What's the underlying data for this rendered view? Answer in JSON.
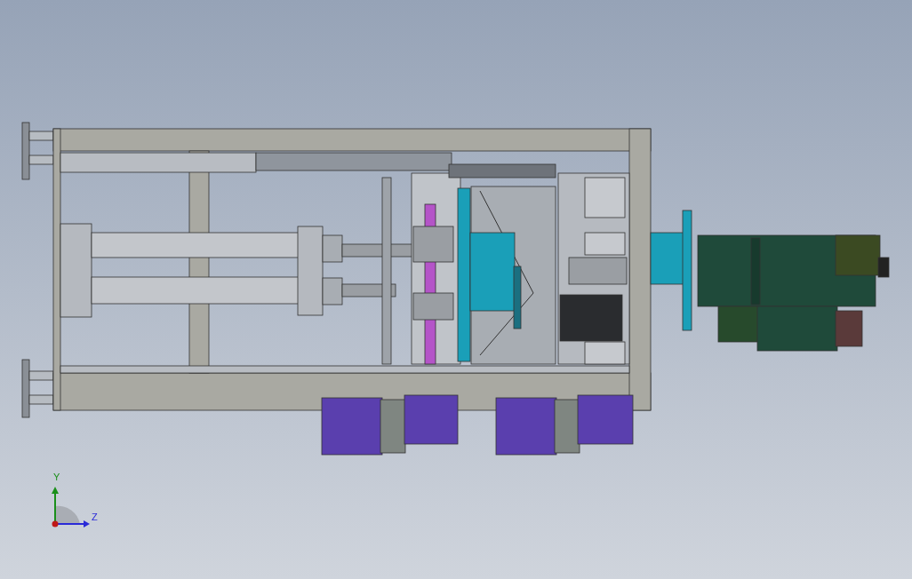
{
  "triad": {
    "axes": [
      {
        "kind": "y",
        "label": "Y"
      },
      {
        "kind": "z",
        "label": "Z"
      }
    ]
  }
}
